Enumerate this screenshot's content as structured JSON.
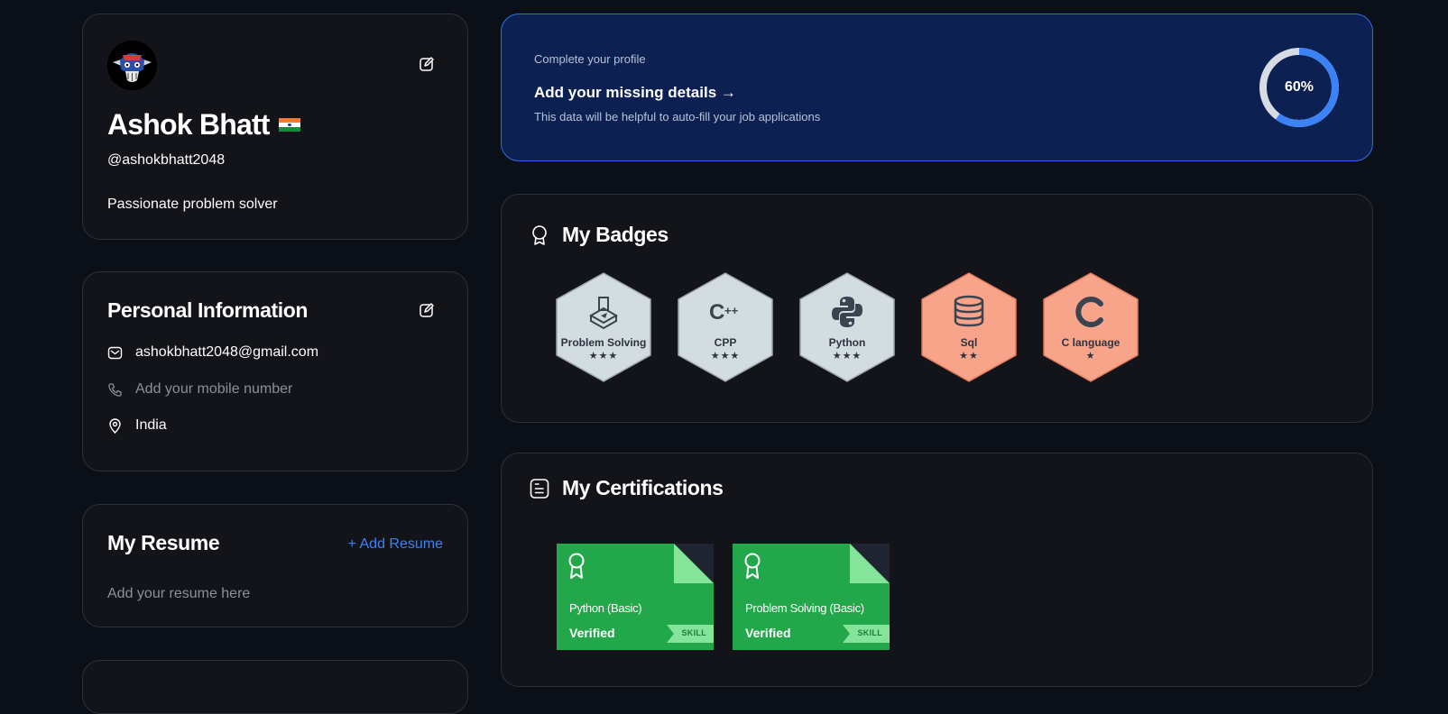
{
  "profile": {
    "name": "Ashok Bhatt",
    "flag_icon": "india-flag-icon",
    "handle": "@ashokbhatt2048",
    "bio": "Passionate problem solver"
  },
  "personal_info": {
    "title": "Personal Information",
    "email": "ashokbhatt2048@gmail.com",
    "mobile_placeholder": "Add your mobile number",
    "location": "India"
  },
  "resume": {
    "title": "My Resume",
    "add_label": "+ Add Resume",
    "placeholder": "Add your resume here"
  },
  "complete_profile": {
    "small": "Complete your profile",
    "title": "Add your missing details →",
    "description": "This data will be helpful to auto-fill your job applications",
    "progress": 0.6,
    "progress_label": "60%"
  },
  "badges": {
    "title": "My Badges",
    "items": [
      {
        "label": "Problem Solving",
        "stars": "★★★",
        "tier": "silver",
        "icon": "problem-solving-icon"
      },
      {
        "label": "CPP",
        "stars": "★★★",
        "tier": "silver",
        "icon": "cpp-icon"
      },
      {
        "label": "Python",
        "stars": "★★★",
        "tier": "silver",
        "icon": "python-icon"
      },
      {
        "label": "Sql",
        "stars": "★★",
        "tier": "bronze",
        "icon": "database-icon"
      },
      {
        "label": "C language",
        "stars": "★",
        "tier": "bronze",
        "icon": "c-language-icon"
      }
    ]
  },
  "certifications": {
    "title": "My Certifications",
    "items": [
      {
        "name": "Python (Basic)",
        "status": "Verified",
        "tag": "SKILL"
      },
      {
        "name": "Problem Solving (Basic)",
        "status": "Verified",
        "tag": "SKILL"
      }
    ]
  },
  "colors": {
    "page_bg": "#0b0f17",
    "card_bg": "#131419",
    "banner_bg": "#0c2051",
    "accent_blue": "#3b82f6",
    "cert_green": "#22a84a",
    "badge_silver": "#d6dee1",
    "badge_bronze": "#f9a58a"
  }
}
